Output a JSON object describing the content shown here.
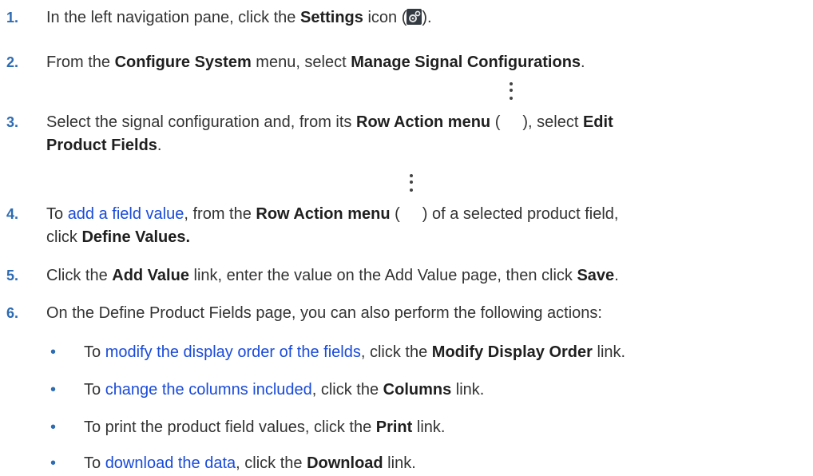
{
  "steps": [
    {
      "num": "1.",
      "t1": "In the left navigation pane, click the ",
      "b1": "Settings",
      "t2": " icon (",
      "t3": ")."
    },
    {
      "num": "2.",
      "t1": "From the ",
      "b1": "Configure System",
      "t2": " menu, select ",
      "b2": "Manage Signal Configurations",
      "t3": "."
    },
    {
      "num": "3.",
      "t1": "Select the signal configuration and, from its ",
      "b1": "Row Action menu",
      "t2": " (",
      "t3": "), select ",
      "b2": "Edit",
      "b3": "Product Fields",
      "t4": "."
    },
    {
      "num": "4.",
      "t1": "To ",
      "link": "add a field value",
      "t2": ", from the ",
      "b1": "Row Action menu",
      "t3": " (",
      "t4": ") of a selected product field,",
      "t5": "click ",
      "b2": "Define Values."
    },
    {
      "num": "5.",
      "t1": "Click the ",
      "b1": "Add Value",
      "t2": " link, enter the value on the Add Value page, then click ",
      "b2": "Save",
      "t3": "."
    },
    {
      "num": "6.",
      "t1": "On the Define Product Fields page, you can also perform the following actions:"
    }
  ],
  "bullets": [
    {
      "t1": "To ",
      "link": "modify the display order of the fields",
      "t2": ", click the ",
      "b1": "Modify Display Order",
      "t3": " link."
    },
    {
      "t1": "To ",
      "link": "change the columns included",
      "t2": ", click the ",
      "b1": "Columns",
      "t3": " link."
    },
    {
      "t1": "To print the product field values, click the ",
      "b1": "Print",
      "t3": " link."
    },
    {
      "t1": "To ",
      "link": "download the data",
      "t2": ", click the ",
      "b1": "Download",
      "t3": " link."
    }
  ],
  "bullet_char": "•"
}
